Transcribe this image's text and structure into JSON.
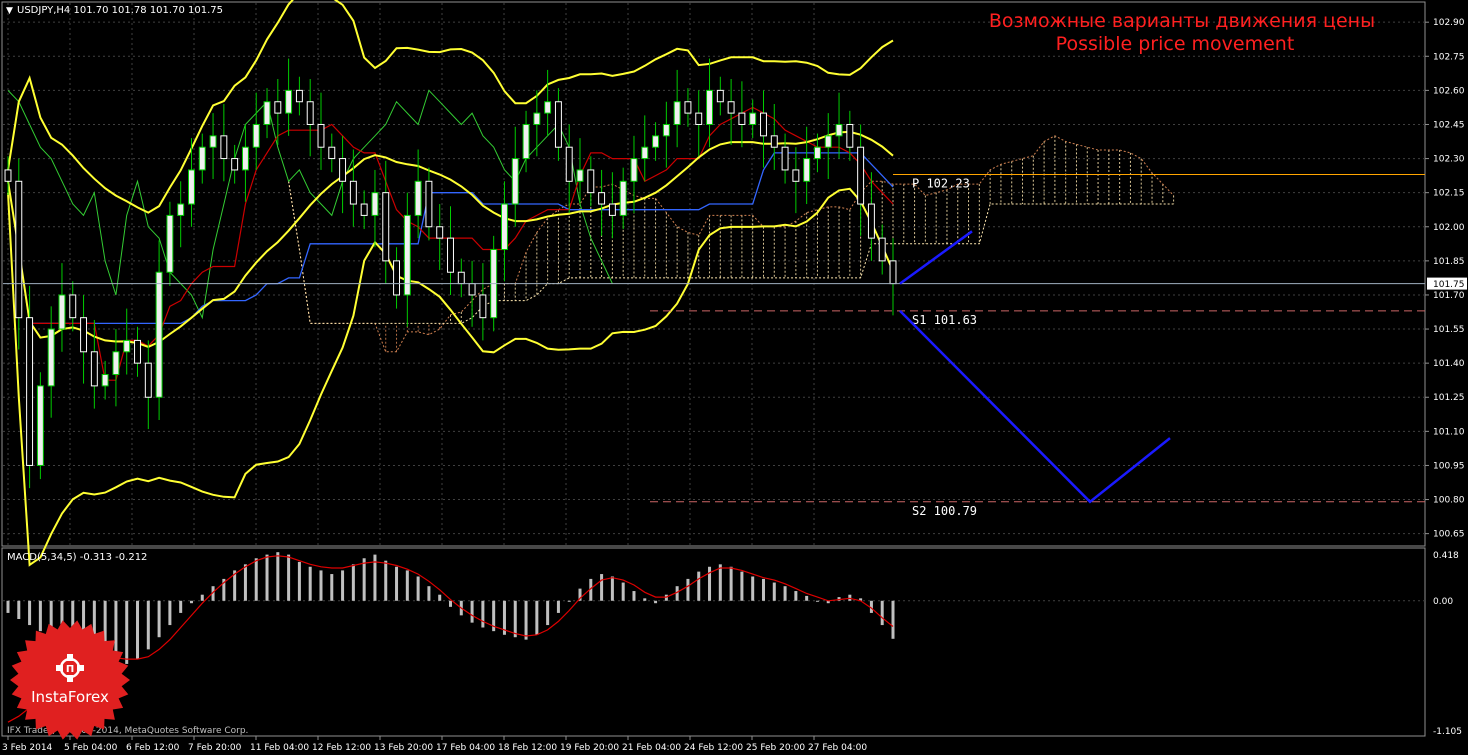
{
  "window": {
    "symbol_header": "USDJPY,H4  101.70 101.78 101.70 101.75",
    "macd_header": "MACD(5,34,5) -0.313 -0.212",
    "copyright": "IFX Trader, © 2001-2014, MetaQuotes Software Corp.",
    "title_ru": "Возможные варианты движения цены",
    "title_en": "Possible price movement",
    "logo_text": "InstaForex"
  },
  "colors": {
    "background": "#000000",
    "grid": "#404040",
    "bull_candle": "#f0f0f0",
    "bear_candle": "#ffffff",
    "wick": "#00cc00",
    "bollinger": "#ffff33",
    "kijun": "#3366ff",
    "tenkan": "#cc0000",
    "chikou": "#33cc33",
    "cloud_up": "#ffe8b0",
    "cloud_down": "#d08050",
    "forecast": "#1a1aff",
    "pivot_line": "#ffa500",
    "support_line": "#cc6666",
    "price_line": "#a0b0c0",
    "title": "#ff2020",
    "macd_hist": "#c0c0c0",
    "macd_signal": "#dd0000",
    "logo": "#e02020"
  },
  "chart_data": [
    {
      "type": "candlestick",
      "symbol": "USDJPY",
      "timeframe": "H4",
      "ylim": [
        100.6,
        102.98
      ],
      "yticks": [
        102.9,
        102.75,
        102.6,
        102.45,
        102.3,
        102.15,
        102.0,
        101.85,
        101.7,
        101.55,
        101.4,
        101.25,
        101.1,
        100.95,
        100.8,
        100.65
      ],
      "current_price": 101.75,
      "x_labels": [
        "3 Feb 2014",
        "5 Feb 04:00",
        "6 Feb 12:00",
        "7 Feb 20:00",
        "11 Feb 04:00",
        "12 Feb 12:00",
        "13 Feb 20:00",
        "17 Feb 04:00",
        "18 Feb 12:00",
        "19 Feb 20:00",
        "21 Feb 04:00",
        "24 Feb 12:00",
        "25 Feb 20:00",
        "27 Feb 04:00"
      ],
      "closes": [
        102.2,
        101.6,
        100.95,
        101.3,
        101.55,
        101.7,
        101.6,
        101.45,
        101.3,
        101.35,
        101.45,
        101.5,
        101.4,
        101.25,
        101.8,
        102.05,
        102.1,
        102.25,
        102.35,
        102.4,
        102.3,
        102.25,
        102.35,
        102.45,
        102.55,
        102.5,
        102.6,
        102.55,
        102.45,
        102.35,
        102.3,
        102.2,
        102.1,
        102.05,
        102.15,
        101.85,
        101.7,
        102.05,
        102.2,
        102.0,
        101.95,
        101.8,
        101.75,
        101.7,
        101.6,
        101.9,
        102.1,
        102.3,
        102.45,
        102.5,
        102.55,
        102.35,
        102.2,
        102.25,
        102.15,
        102.1,
        102.05,
        102.2,
        102.3,
        102.35,
        102.4,
        102.45,
        102.55,
        102.5,
        102.45,
        102.6,
        102.55,
        102.5,
        102.45,
        102.5,
        102.4,
        102.35,
        102.25,
        102.2,
        102.3,
        102.35,
        102.4,
        102.45,
        102.35,
        102.1,
        101.95,
        101.85,
        101.75
      ]
    },
    {
      "type": "levels",
      "levels": [
        {
          "name": "P",
          "label": "P  102.23",
          "value": 102.23
        },
        {
          "name": "S1",
          "label": "S1  101.63",
          "value": 101.63
        },
        {
          "name": "S2",
          "label": "S2  100.79",
          "value": 100.79
        }
      ],
      "forecast_path": [
        [
          101.75,
          101.98
        ],
        [
          101.63,
          100.79,
          101.07
        ]
      ]
    },
    {
      "type": "bar",
      "name": "MACD(5,34,5)",
      "ylim": [
        -1.105,
        0.418
      ],
      "yticks": [
        0.418,
        0.0,
        -1.105
      ],
      "values": [
        -0.1,
        -0.15,
        -0.2,
        -0.25,
        -0.3,
        -0.35,
        -0.38,
        -0.42,
        -0.43,
        -0.45,
        -0.5,
        -0.52,
        -0.48,
        -0.4,
        -0.3,
        -0.2,
        -0.1,
        -0.02,
        0.05,
        0.12,
        0.18,
        0.25,
        0.3,
        0.35,
        0.38,
        0.4,
        0.38,
        0.32,
        0.28,
        0.25,
        0.22,
        0.25,
        0.3,
        0.35,
        0.38,
        0.33,
        0.28,
        0.25,
        0.2,
        0.12,
        0.05,
        -0.05,
        -0.12,
        -0.18,
        -0.22,
        -0.25,
        -0.28,
        -0.3,
        -0.32,
        -0.28,
        -0.2,
        -0.1,
        0.0,
        0.1,
        0.18,
        0.22,
        0.2,
        0.15,
        0.08,
        0.02,
        -0.02,
        0.05,
        0.12,
        0.18,
        0.24,
        0.28,
        0.3,
        0.28,
        0.24,
        0.2,
        0.18,
        0.15,
        0.12,
        0.08,
        0.04,
        0.0,
        -0.02,
        0.03,
        0.05,
        0.02,
        -0.1,
        -0.2,
        -0.313
      ],
      "signal": [
        -1.0,
        -0.95,
        -0.88,
        -0.8,
        -0.72,
        -0.64,
        -0.58,
        -0.53,
        -0.5,
        -0.48,
        -0.47,
        -0.48,
        -0.48,
        -0.46,
        -0.4,
        -0.32,
        -0.22,
        -0.12,
        -0.02,
        0.07,
        0.15,
        0.22,
        0.28,
        0.33,
        0.36,
        0.37,
        0.36,
        0.33,
        0.3,
        0.28,
        0.27,
        0.27,
        0.29,
        0.31,
        0.32,
        0.31,
        0.29,
        0.26,
        0.22,
        0.16,
        0.09,
        0.01,
        -0.06,
        -0.12,
        -0.17,
        -0.21,
        -0.24,
        -0.27,
        -0.29,
        -0.28,
        -0.24,
        -0.17,
        -0.08,
        0.02,
        0.1,
        0.17,
        0.19,
        0.17,
        0.13,
        0.07,
        0.03,
        0.03,
        0.07,
        0.12,
        0.18,
        0.23,
        0.27,
        0.27,
        0.25,
        0.22,
        0.19,
        0.17,
        0.14,
        0.1,
        0.06,
        0.03,
        0.0,
        0.01,
        0.02,
        0.0,
        -0.06,
        -0.14,
        -0.212
      ]
    }
  ]
}
